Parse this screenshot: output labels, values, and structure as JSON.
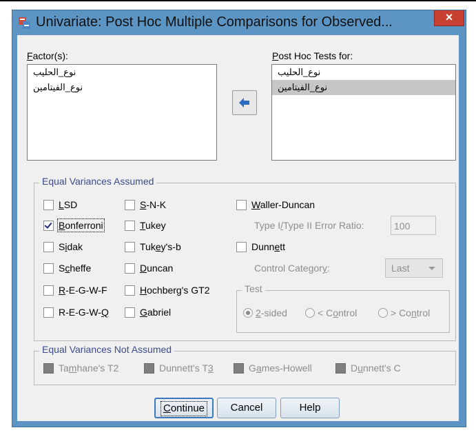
{
  "window": {
    "title": "Univariate: Post Hoc Multiple Comparisons for Observed...",
    "close_glyph": "×"
  },
  "factors": {
    "label_prefix": "",
    "label_u": "F",
    "label_rest": "actor(s):",
    "items": [
      "نوع_الحليب",
      "نوع_الفيتامين"
    ]
  },
  "posthoc": {
    "label_u": "P",
    "label_rest": "ost Hoc Tests for:",
    "items": [
      "نوع_الحليب",
      "نوع_الفيتامين"
    ],
    "selected_index": 1
  },
  "equal_assumed": {
    "title": "Equal Variances Assumed",
    "lsd": {
      "u": "L",
      "rest": "SD",
      "checked": false
    },
    "bonferroni": {
      "u": "B",
      "rest": "onferroni",
      "checked": true
    },
    "sidak": {
      "pre": "S",
      "u": "i",
      "rest": "dak",
      "checked": false
    },
    "scheffe": {
      "pre": "S",
      "u": "c",
      "rest": "heffe",
      "checked": false
    },
    "regwf": {
      "u": "R",
      "rest": "-E-G-W-F",
      "checked": false
    },
    "regwq": {
      "pre": "R-E-G-W-",
      "u": "Q",
      "rest": "",
      "checked": false
    },
    "snk": {
      "u": "S",
      "rest": "-N-K",
      "checked": false
    },
    "tukey": {
      "u": "T",
      "rest": "ukey",
      "checked": false
    },
    "tukeyb": {
      "pre": "Tuk",
      "u": "e",
      "rest": "y's-b",
      "checked": false
    },
    "duncan": {
      "u": "D",
      "rest": "uncan",
      "checked": false
    },
    "hochberg": {
      "u": "H",
      "rest": "ochberg's GT2",
      "checked": false
    },
    "gabriel": {
      "u": "G",
      "rest": "abriel",
      "checked": false
    },
    "waller": {
      "u": "W",
      "rest": "aller-Duncan",
      "checked": false
    },
    "error_ratio_label": {
      "pre": "Type I",
      "u": "/",
      "rest": "Type II Error Ratio:"
    },
    "error_ratio_value": "100",
    "dunnett": {
      "pre": "Dunn",
      "u": "e",
      "rest": "tt",
      "checked": false
    },
    "control_category_label": {
      "pre": "Control Categor",
      "u": "y",
      "rest": ":"
    },
    "control_category_value": "Last",
    "test_title": "Test",
    "two_sided": {
      "u": "2",
      "rest": "-sided",
      "selected": true
    },
    "lt_control": {
      "pre": "< C",
      "u": "o",
      "rest": "ntrol",
      "selected": false
    },
    "gt_control": {
      "pre": "> Co",
      "u": "n",
      "rest": "trol",
      "selected": false
    }
  },
  "not_assumed": {
    "title": "Equal Variances Not Assumed",
    "tamhane": {
      "pre": "Ta",
      "u": "m",
      "rest": "hane's T2"
    },
    "dunnett_t3": {
      "pre": "Dunnett's T",
      "u": "3",
      "rest": ""
    },
    "games_howell": {
      "pre": "G",
      "u": "a",
      "rest": "mes-Howell"
    },
    "dunnett_c": {
      "pre": "D",
      "u": "u",
      "rest": "nnett's C"
    }
  },
  "buttons": {
    "continue": {
      "u": "C",
      "rest": "ontinue"
    },
    "cancel": "Cancel",
    "help": "Help"
  },
  "colors": {
    "window_frame": "#5c94c4",
    "close_button": "#c84031",
    "group_title": "#3b4a8a",
    "arrow": "#2d6cc0"
  }
}
